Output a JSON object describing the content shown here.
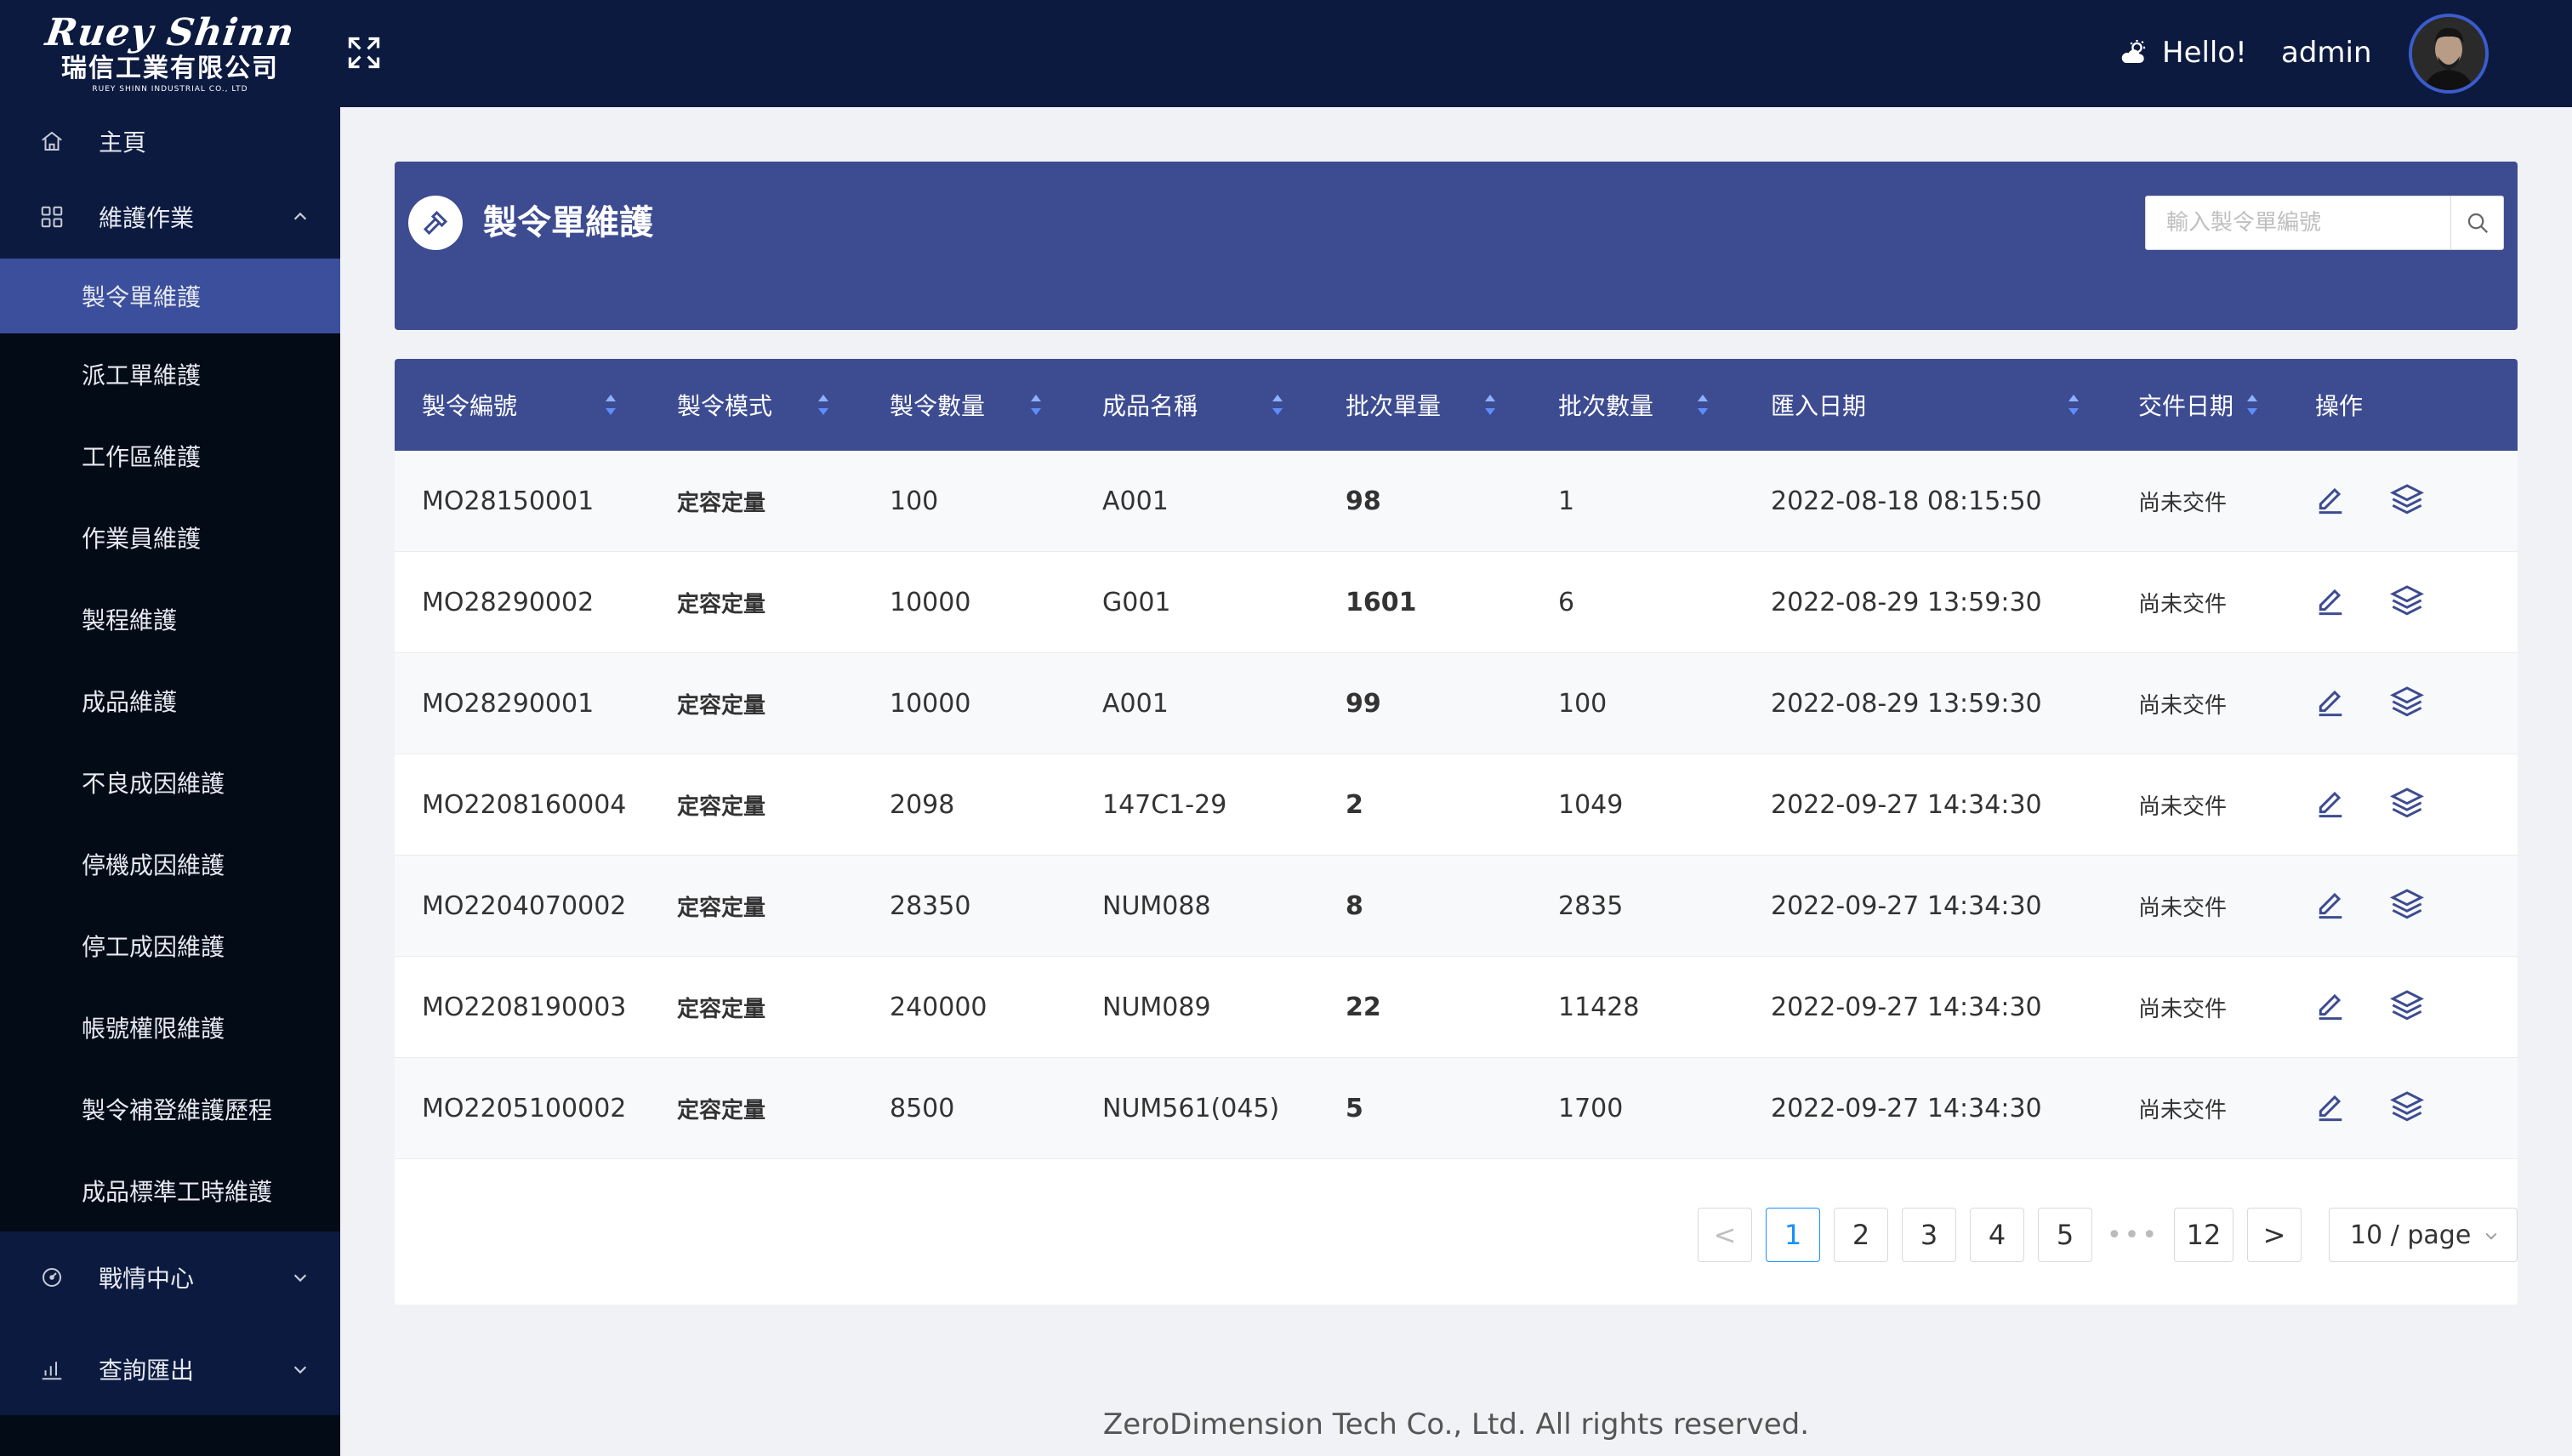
{
  "brand": {
    "logo_text": "Ruey Shinn",
    "company_cn": "瑞信工業有限公司",
    "company_en": "RUEY SHINN INDUSTRIAL CO., LTD"
  },
  "sidebar": {
    "home": "主頁",
    "group_maintenance": "維護作業",
    "items": [
      "製令單維護",
      "派工單維護",
      "工作區維護",
      "作業員維護",
      "製程維護",
      "成品維護",
      "不良成因維護",
      "停機成因維護",
      "停工成因維護",
      "帳號權限維護",
      "製令補登維護歷程",
      "成品標準工時維護"
    ],
    "group_war_room": "戰情中心",
    "group_query": "查詢匯出"
  },
  "header": {
    "greeting": "Hello!",
    "user": "admin"
  },
  "page": {
    "title": "製令單維護",
    "search_placeholder": "輸入製令單編號"
  },
  "table": {
    "columns": [
      "製令編號",
      "製令模式",
      "製令數量",
      "成品名稱",
      "批次單量",
      "批次數量",
      "匯入日期",
      "交件日期",
      "操作"
    ],
    "rows": [
      [
        "MO28150001",
        "定容定量",
        "100",
        "A001",
        "98",
        "1",
        "2022-08-18 08:15:50",
        "尚未交件"
      ],
      [
        "MO28290002",
        "定容定量",
        "10000",
        "G001",
        "1601",
        "6",
        "2022-08-29 13:59:30",
        "尚未交件"
      ],
      [
        "MO28290001",
        "定容定量",
        "10000",
        "A001",
        "99",
        "100",
        "2022-08-29 13:59:30",
        "尚未交件"
      ],
      [
        "MO2208160004",
        "定容定量",
        "2098",
        "147C1-29",
        "2",
        "1049",
        "2022-09-27 14:34:30",
        "尚未交件"
      ],
      [
        "MO2204070002",
        "定容定量",
        "28350",
        "NUM088",
        "8",
        "2835",
        "2022-09-27 14:34:30",
        "尚未交件"
      ],
      [
        "MO2208190003",
        "定容定量",
        "240000",
        "NUM089",
        "22",
        "11428",
        "2022-09-27 14:34:30",
        "尚未交件"
      ],
      [
        "MO2205100002",
        "定容定量",
        "8500",
        "NUM561(045)",
        "5",
        "1700",
        "2022-09-27 14:34:30",
        "尚未交件"
      ]
    ]
  },
  "pagination": {
    "prev": "<",
    "pages": [
      "1",
      "2",
      "3",
      "4",
      "5"
    ],
    "ellipsis": "•••",
    "last": "12",
    "next": ">",
    "current": "1",
    "page_size": "10 / page"
  },
  "footer": "ZeroDimension Tech Co., Ltd. All rights reserved.",
  "colors": {
    "sidebar_bg": "#030b17",
    "header_bg": "#0c1a3f",
    "accent": "#3d4c91",
    "active_item": "#3b4f9c",
    "pager_active": "#1890ff"
  }
}
